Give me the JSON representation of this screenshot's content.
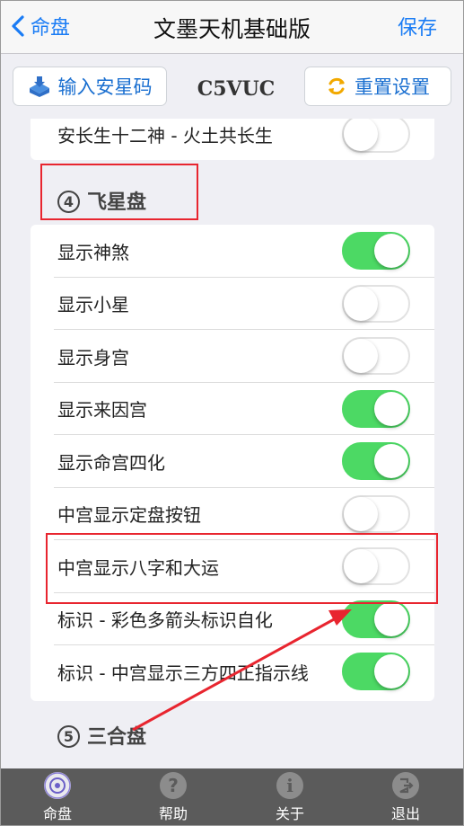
{
  "nav": {
    "back_label": "命盘",
    "title": "文墨天机基础版",
    "save_label": "保存"
  },
  "toolbar": {
    "input_label": "输入安星码",
    "code": "C5VUC",
    "reset_label": "重置设置"
  },
  "top_row": {
    "label": "安长生十二神 - 火土共长生",
    "on": false
  },
  "section4": {
    "number": "④",
    "title": "飞星盘"
  },
  "rows": [
    {
      "label": "显示神煞",
      "on": true
    },
    {
      "label": "显示小星",
      "on": false
    },
    {
      "label": "显示身宫",
      "on": false
    },
    {
      "label": "显示来因宫",
      "on": true
    },
    {
      "label": "显示命宫四化",
      "on": true
    },
    {
      "label": "中宫显示定盘按钮",
      "on": false
    },
    {
      "label": "中宫显示八字和大运",
      "on": false
    },
    {
      "label": "标识 - 彩色多箭头标识自化",
      "on": true
    },
    {
      "label": "标识 - 中宫显示三方四正指示线",
      "on": true
    }
  ],
  "section5": {
    "number": "⑤",
    "title": "三合盘"
  },
  "tabs": [
    {
      "label": "命盘",
      "icon": "disc-icon"
    },
    {
      "label": "帮助",
      "icon": "help-icon"
    },
    {
      "label": "关于",
      "icon": "info-icon"
    },
    {
      "label": "退出",
      "icon": "exit-icon"
    }
  ],
  "colors": {
    "accent": "#1a7cf5",
    "toggle_on": "#4cd964",
    "highlight": "#e8252f",
    "tabbar": "#5b5b5b"
  }
}
